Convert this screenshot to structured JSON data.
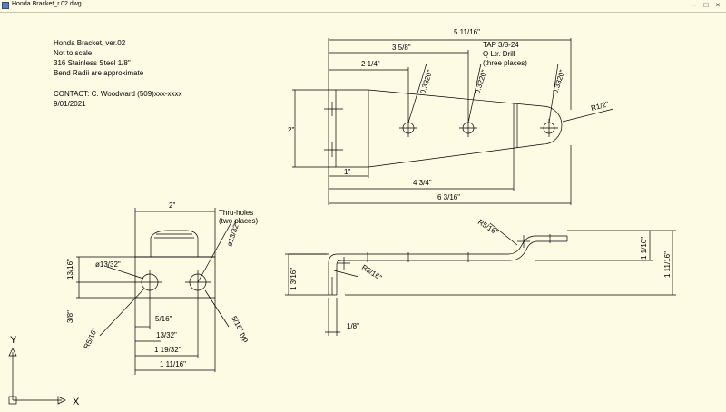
{
  "window": {
    "title": "Honda Bracket_r.02.dwg",
    "minimize": "–",
    "maximize": "□",
    "close": "×"
  },
  "notes": [
    "Honda Bracket, ver.02",
    "Not to scale",
    "316 Stainless Steel 1/8\"",
    "Bend Radii are approximate"
  ],
  "contact": "CONTACT: C. Woodward (509)xxx-xxxx",
  "date": "9/01/2021",
  "top_view": {
    "dim_overall": "5 11/16\"",
    "dim_3_5_8": "3 5/8\"",
    "dim_2_1_4": "2 1/4\"",
    "dim_2": "2\"",
    "dim_1": "1\"",
    "dim_4_3_4": "4 3/4\"",
    "dim_6_3_16": "6 3/16\"",
    "hole_dim_1": "0.3320\"",
    "hole_dim_2": "0.3220\"",
    "hole_dim_3": "0.3320\"",
    "radius": "R1/2\"",
    "tap_note": [
      "TAP 3/8-24",
      "Q Ltr. Drill",
      "(three places)"
    ]
  },
  "front_view": {
    "dim_width": "2\"",
    "thru_note": [
      "Thru-holes",
      "(two places)"
    ],
    "dia_left": "ø13/32\"",
    "dia_right": "ø13/32\"",
    "dim_13_16": "13/16\"",
    "dim_3_8": "3/8\"",
    "radius_left": "R5/16\"",
    "dim_5_16": "5/16\"",
    "dim_13_32": "13/32\"",
    "dim_1_19_32": "1 19/32\"",
    "dim_1_11_16": "1 11/16\"",
    "chamfer": "5/16\" typ"
  },
  "side_view": {
    "radius_top": "R5/16\"",
    "radius_bottom": "R3/16\"",
    "dim_1_3_16": "1 3/16\"",
    "dim_1_1_16": "1 1/16\"",
    "dim_1_11_16": "1 11/16\"",
    "dim_1_8": "1/8\""
  },
  "ucs": {
    "x": "X",
    "y": "Y"
  }
}
